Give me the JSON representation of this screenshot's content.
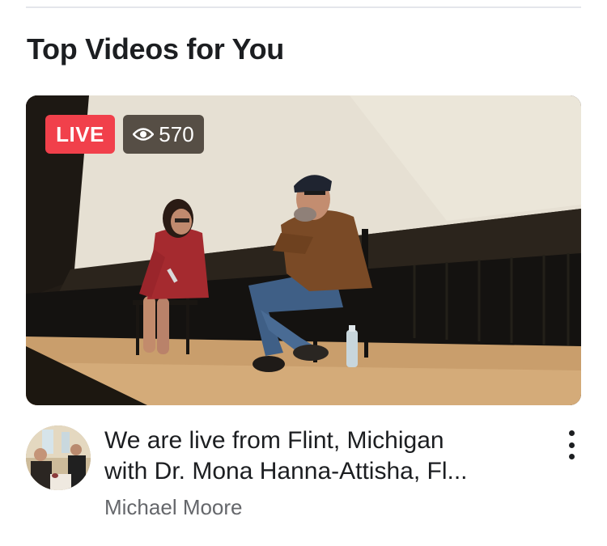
{
  "section": {
    "title": "Top Videos for You"
  },
  "video": {
    "live_label": "LIVE",
    "viewers_count": "570",
    "viewers_icon": "eye-icon"
  },
  "post": {
    "title_line1": "We are live from Flint, Michigan",
    "title_line2": "with Dr. Mona Hanna-Attisha, Fl...",
    "author": "Michael Moore",
    "more_icon": "more-vertical-icon"
  },
  "colors": {
    "live_badge": "#f1404b",
    "title_text": "#1c1e21",
    "secondary_text": "#65676b"
  }
}
